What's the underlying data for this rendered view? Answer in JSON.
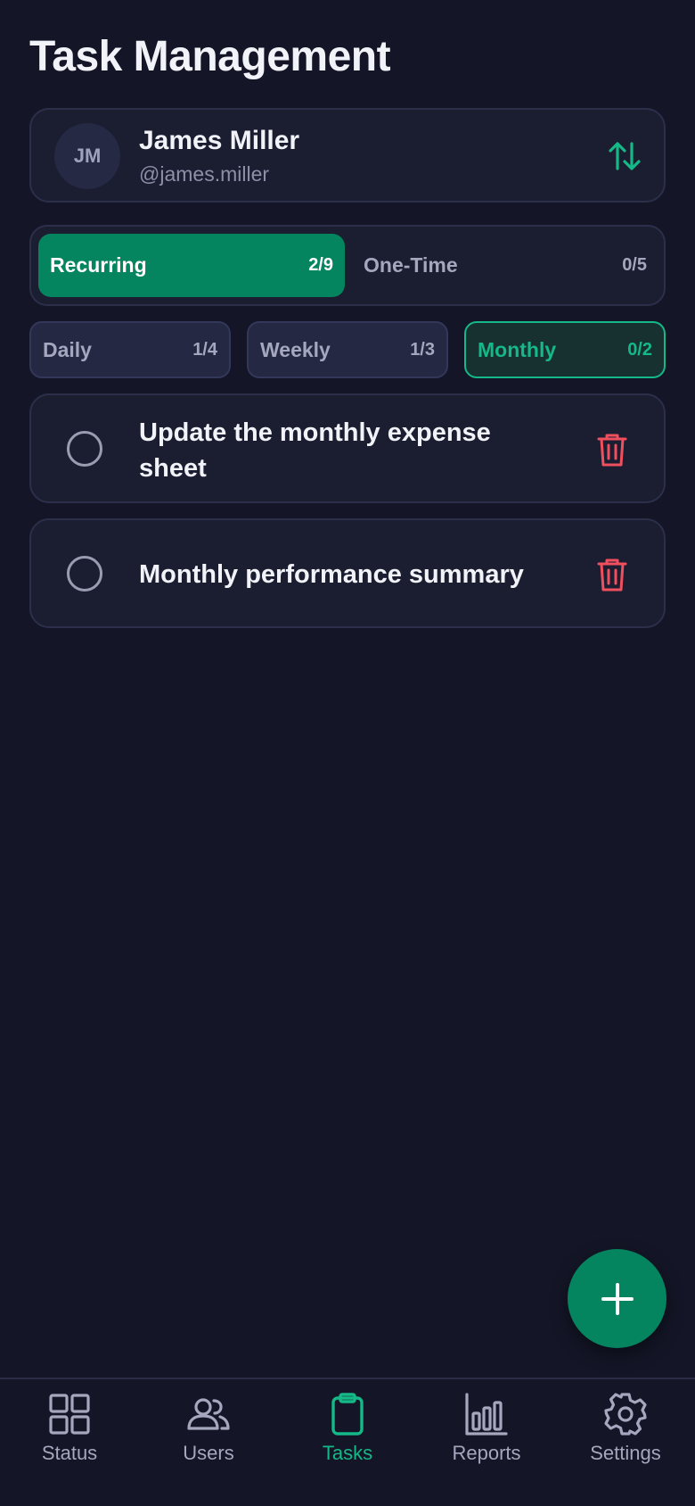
{
  "page": {
    "title": "Task Management"
  },
  "user": {
    "initials": "JM",
    "name": "James Miller",
    "handle": "@james.miller",
    "switch_icon": "swap-vertical-icon"
  },
  "main_tabs": [
    {
      "label": "Recurring",
      "count": "2/9",
      "active": true
    },
    {
      "label": "One-Time",
      "count": "0/5",
      "active": false
    }
  ],
  "sub_tabs": [
    {
      "label": "Daily",
      "count": "1/4",
      "active": false
    },
    {
      "label": "Weekly",
      "count": "1/3",
      "active": false
    },
    {
      "label": "Monthly",
      "count": "0/2",
      "active": true
    }
  ],
  "tasks": [
    {
      "title": "Update the monthly expense sheet",
      "done": false
    },
    {
      "title": "Monthly performance summary",
      "done": false
    }
  ],
  "fab": {
    "icon": "plus-icon"
  },
  "nav": [
    {
      "label": "Status",
      "icon": "grid-icon",
      "active": false
    },
    {
      "label": "Users",
      "icon": "users-icon",
      "active": false
    },
    {
      "label": "Tasks",
      "icon": "clipboard-icon",
      "active": true
    },
    {
      "label": "Reports",
      "icon": "bar-chart-icon",
      "active": false
    },
    {
      "label": "Settings",
      "icon": "gear-icon",
      "active": false
    }
  ],
  "colors": {
    "background": "#141627",
    "card": "#1b1d31",
    "accent": "#04845f",
    "accent_text": "#15b887",
    "danger": "#f0505e",
    "muted": "#a4a7bd"
  }
}
